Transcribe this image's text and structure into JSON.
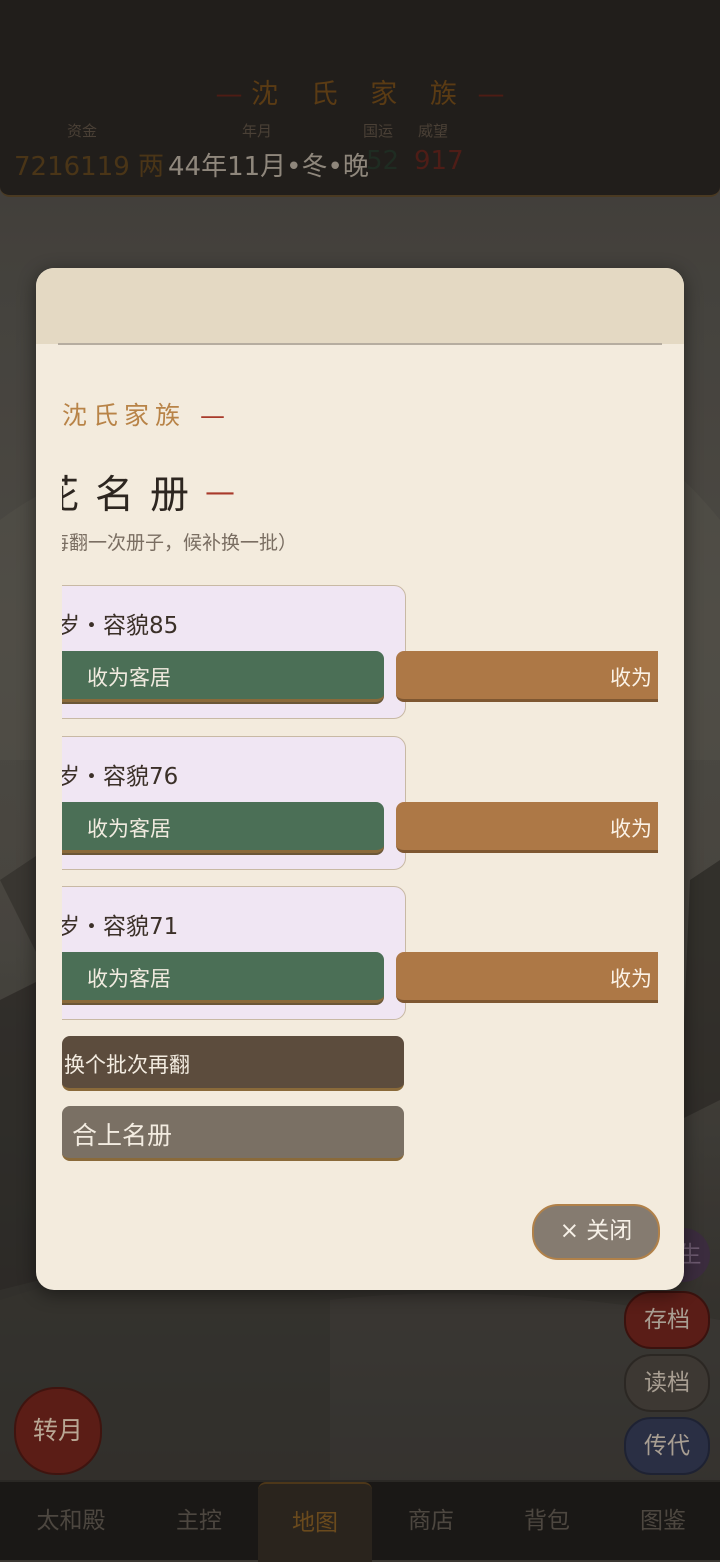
{
  "header": {
    "family_title": "沈 氏 家 族",
    "stats": [
      {
        "label": "资金",
        "value": "7216119 两",
        "color": "#4a3517"
      },
      {
        "label": "年月",
        "value": "44年11月•冬•晚",
        "color": "#8f877c"
      },
      {
        "label": "国运",
        "value": "52",
        "color": "#1f2c22"
      },
      {
        "label": "威望",
        "value": "917",
        "color": "#4e1d17"
      }
    ]
  },
  "modal": {
    "family_label": "沈氏家族",
    "title": "花名册",
    "subtitle": "每翻一次册子，候补换一批）",
    "candidates": [
      {
        "info": "岁・容貌85",
        "accept_label": "收为客居",
        "other_label": "收为"
      },
      {
        "info": "岁・容貌76",
        "accept_label": "收为客居",
        "other_label": "收为"
      },
      {
        "info": "岁・容貌71",
        "accept_label": "收为客居",
        "other_label": "收为"
      }
    ],
    "refresh_label": "换个批次再翻",
    "close_book_label": "合上名册",
    "close_label": "× 关闭"
  },
  "side_buttons": {
    "save": "存档",
    "load": "读档",
    "pass_on": "传代",
    "partial": "生"
  },
  "turn_button": "转月",
  "nav": {
    "tabs": [
      "太和殿",
      "主控",
      "地图",
      "商店",
      "背包",
      "图鉴"
    ],
    "active": "地图"
  }
}
